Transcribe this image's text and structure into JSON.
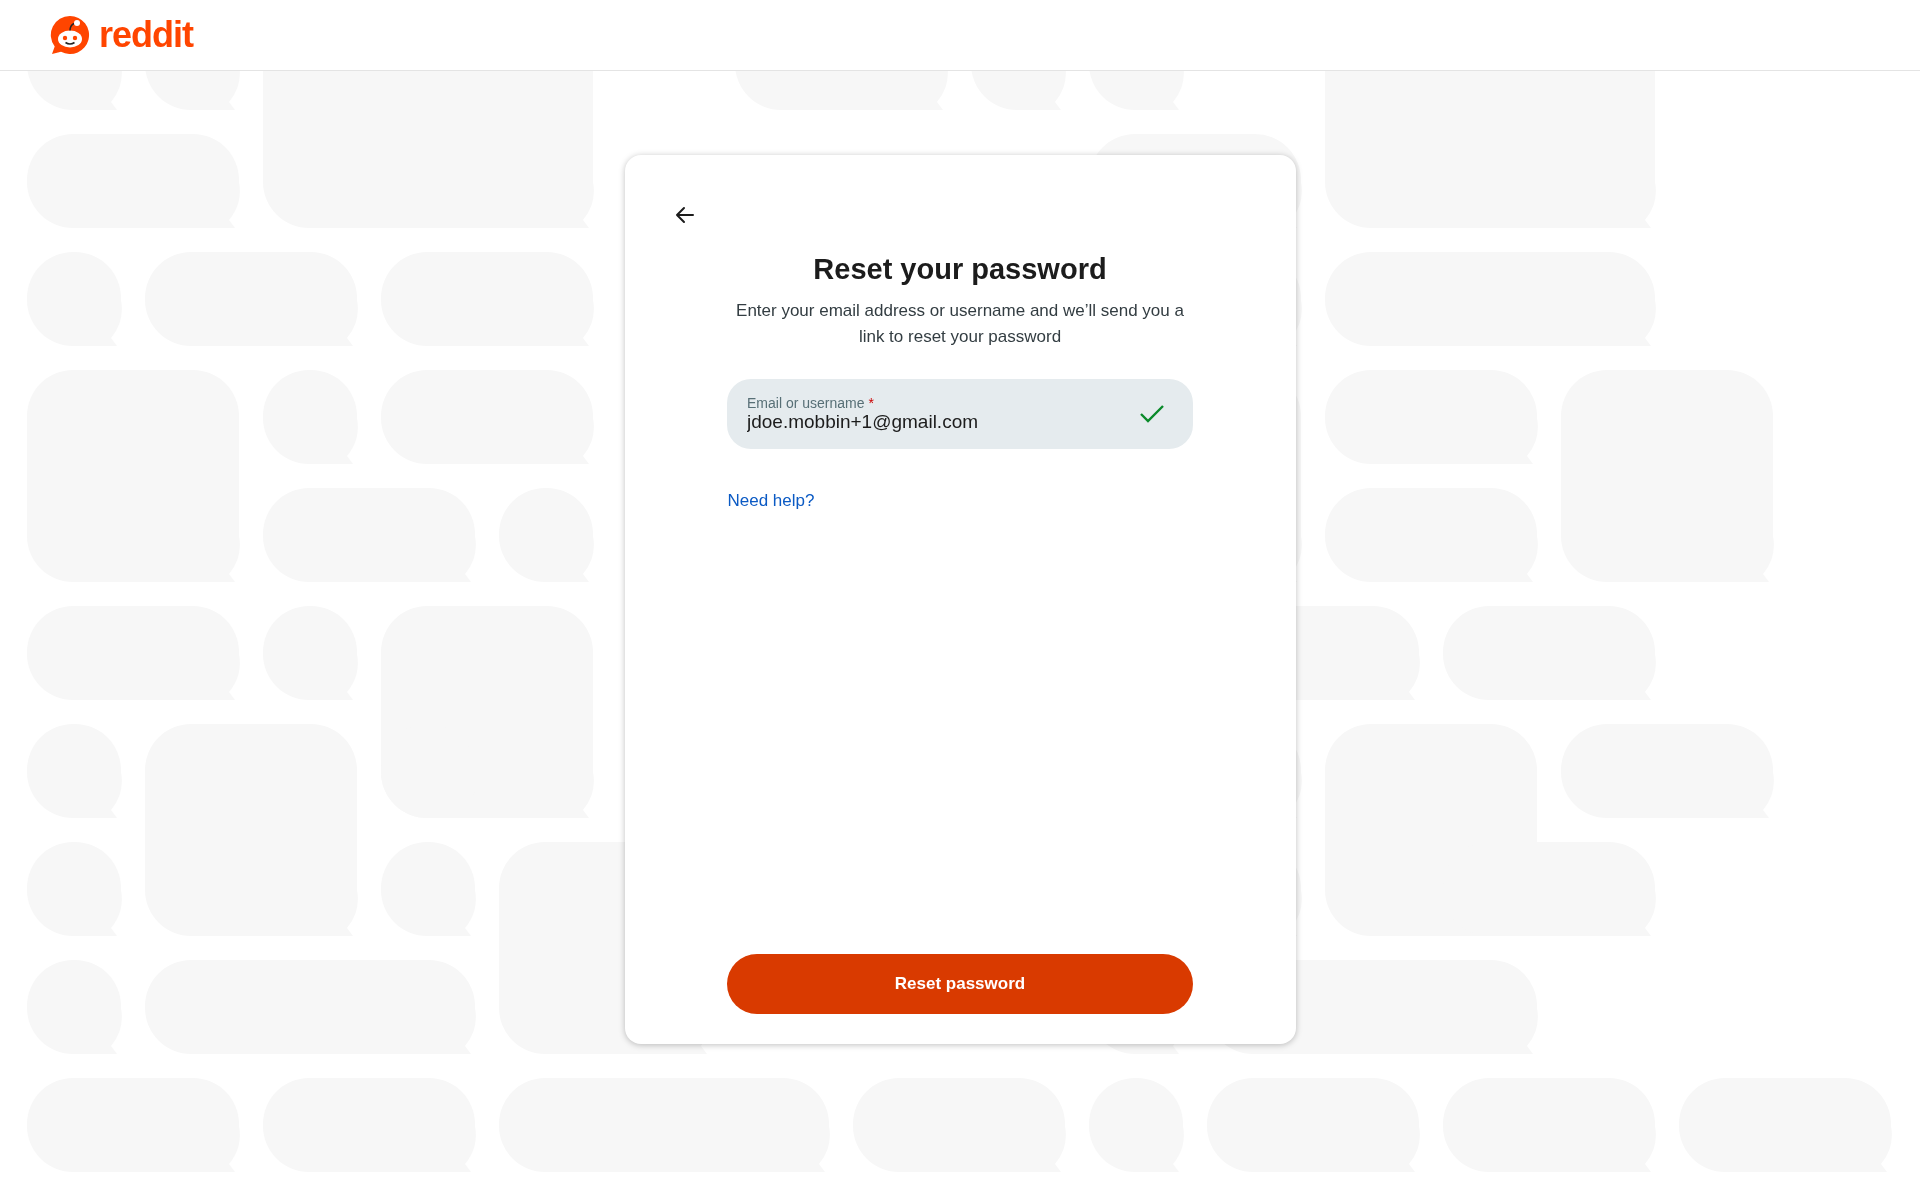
{
  "header": {
    "logo_text": "reddit"
  },
  "card": {
    "title": "Reset your password",
    "subtitle": "Enter your email address or username and we’ll send you a link to reset your password",
    "field": {
      "label": "Email or username",
      "required_mark": "*",
      "value": "jdoe.mobbin+1@gmail.com",
      "valid": true
    },
    "help_link": "Need help?",
    "button": "Reset password"
  }
}
